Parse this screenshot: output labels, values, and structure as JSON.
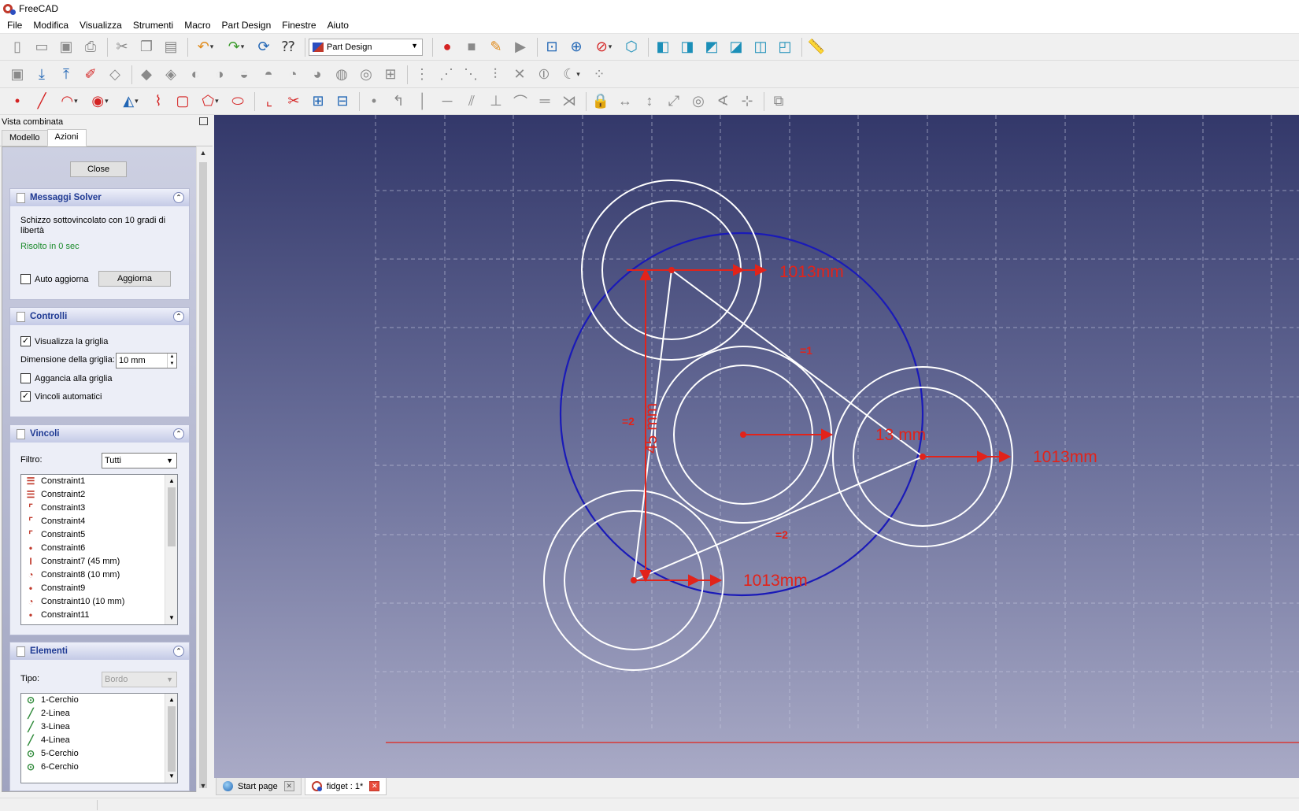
{
  "window": {
    "title": "FreeCAD"
  },
  "menu": [
    "File",
    "Modifica",
    "Visualizza",
    "Strumenti",
    "Macro",
    "Part Design",
    "Finestre",
    "Aiuto"
  ],
  "workbench": {
    "selected": "Part Design"
  },
  "combo_view": {
    "title": "Vista combinata",
    "tabs": [
      "Modello",
      "Azioni"
    ],
    "active_tab": "Azioni",
    "close_label": "Close",
    "solver": {
      "title": "Messaggi Solver",
      "message": "Schizzo sottovincolato con 10 gradi di libertà",
      "solved": "Risolto in 0 sec",
      "auto_update_label": "Auto aggiorna",
      "auto_update_checked": false,
      "update_label": "Aggiorna"
    },
    "controls": {
      "title": "Controlli",
      "show_grid_label": "Visualizza la griglia",
      "show_grid_checked": true,
      "grid_size_label": "Dimensione della griglia:",
      "grid_size_value": "10 mm",
      "snap_label": "Aggancia alla griglia",
      "snap_checked": false,
      "auto_constraints_label": "Vincoli automatici",
      "auto_constraints_checked": true
    },
    "constraints": {
      "title": "Vincoli",
      "filter_label": "Filtro:",
      "filter_value": "Tutti",
      "items": [
        {
          "label": "Constraint1",
          "icon": "equal-icon"
        },
        {
          "label": "Constraint2",
          "icon": "equal-icon"
        },
        {
          "label": "Constraint3",
          "icon": "tangent-icon"
        },
        {
          "label": "Constraint4",
          "icon": "tangent-icon"
        },
        {
          "label": "Constraint5",
          "icon": "tangent-icon"
        },
        {
          "label": "Constraint6",
          "icon": "point-on-object-icon"
        },
        {
          "label": "Constraint7 (45 mm)",
          "icon": "vertical-distance-icon"
        },
        {
          "label": "Constraint8 (10 mm)",
          "icon": "radius-icon"
        },
        {
          "label": "Constraint9",
          "icon": "point-on-object-icon"
        },
        {
          "label": "Constraint10 (10 mm)",
          "icon": "radius-icon"
        },
        {
          "label": "Constraint11",
          "icon": "point-on-object-icon"
        }
      ]
    },
    "elements": {
      "title": "Elementi",
      "type_label": "Tipo:",
      "type_value": "Bordo",
      "items": [
        {
          "label": "1-Cerchio",
          "icon": "circle-icon"
        },
        {
          "label": "2-Linea",
          "icon": "line-icon"
        },
        {
          "label": "3-Linea",
          "icon": "line-icon"
        },
        {
          "label": "4-Linea",
          "icon": "line-icon"
        },
        {
          "label": "5-Cerchio",
          "icon": "circle-icon"
        },
        {
          "label": "6-Cerchio",
          "icon": "circle-icon"
        }
      ]
    }
  },
  "sketch": {
    "dimension_labels": [
      "1013mm",
      "13 mm",
      "1013mm",
      "1013mm",
      "45 mm"
    ],
    "constraint_marks": [
      "=1",
      "=2",
      "=2"
    ],
    "colors": {
      "geometry": "#ffffff",
      "constraint": "#e2231a",
      "construction": "#1a1ab8",
      "grid": "#c8cbe0"
    }
  },
  "doc_tabs": [
    {
      "label": "Start page",
      "icon": "globe-icon",
      "active": false
    },
    {
      "label": "fidget : 1*",
      "icon": "freecad-doc-icon",
      "active": true
    }
  ]
}
